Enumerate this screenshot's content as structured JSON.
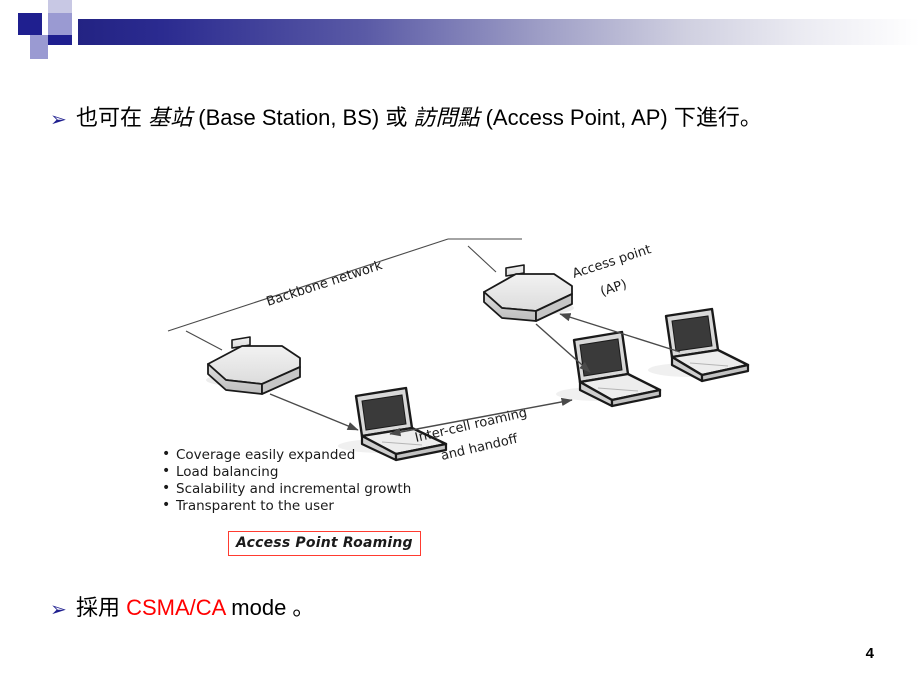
{
  "slide": {
    "page_number": "4",
    "bullets": [
      {
        "marker": "➢",
        "segments": [
          {
            "text": "也可在 ",
            "style": "normal"
          },
          {
            "text": "基站",
            "style": "italic"
          },
          {
            "text": " (Base Station, BS) 或 ",
            "style": "normal"
          },
          {
            "text": "訪問點",
            "style": "italic"
          },
          {
            "text": " (Access Point, AP) 下進行。",
            "style": "normal"
          }
        ],
        "plain": "也可在 基站 (Base Station, BS) 或 訪問點 (Access Point, AP) 下進行。"
      },
      {
        "marker": "➢",
        "segments": [
          {
            "text": "採用 ",
            "style": "normal"
          },
          {
            "text": "CSMA/CA",
            "style": "red"
          },
          {
            "text": " mode 。",
            "style": "normal"
          }
        ],
        "plain": "採用 CSMA/CA mode 。"
      }
    ],
    "bullet_1": {
      "part1": "也可在 ",
      "part2_italic": "基站",
      "part3": " (Base Station, BS) 或 ",
      "part4_italic": "訪問點",
      "part5": " (Access Point, AP) 下進行。"
    },
    "bullet_2": {
      "part1": "採用 ",
      "part2_red": "CSMA/CA",
      "part3": " mode 。"
    }
  },
  "diagram": {
    "title_caption": "Access Point Roaming",
    "labels": {
      "backbone": "Backbone network",
      "access_point_line1": "Access point",
      "access_point_line2": "(AP)",
      "roaming_line1": "Inter-cell roaming",
      "roaming_line2": "and handoff"
    },
    "features": [
      "Coverage easily expanded",
      "Load balancing",
      "Scalability and incremental growth",
      "Transparent to the user"
    ],
    "nodes": [
      {
        "name": "access-point-left",
        "type": "access-point"
      },
      {
        "name": "access-point-right",
        "type": "access-point"
      },
      {
        "name": "laptop-left",
        "type": "laptop"
      },
      {
        "name": "laptop-center",
        "type": "laptop"
      },
      {
        "name": "laptop-right",
        "type": "laptop"
      }
    ]
  },
  "colors": {
    "accent_navy": "#1f1f8f",
    "accent_mid": "#9a9ad2",
    "accent_light": "#c8c8e4",
    "caption_border_red": "#ff3b30",
    "highlight_red": "#ff0000",
    "device_fill": "#e8e8e8",
    "screen_fill": "#3a3a3a"
  }
}
